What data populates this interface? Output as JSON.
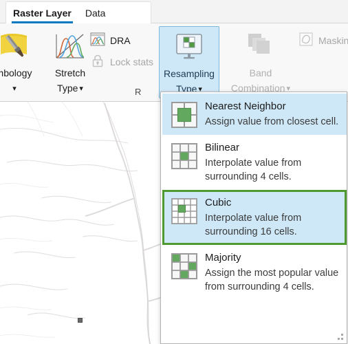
{
  "window": {
    "tabs": [
      {
        "label": "Raster Layer",
        "active": true
      },
      {
        "label": "Data",
        "active": false
      }
    ]
  },
  "ribbon": {
    "group_label_rendering": "R",
    "buttons": [
      {
        "id": "symbology",
        "label_line1": "mbology",
        "label_line2": "",
        "icon": "symbology-icon",
        "state": "enabled",
        "has_chevron": true
      },
      {
        "id": "stretch-type",
        "label_line1": "Stretch",
        "label_line2": "Type",
        "icon": "stretch-type-icon",
        "state": "enabled",
        "has_chevron": true
      },
      {
        "id": "resampling-type",
        "label_line1": "Resampling",
        "label_line2": "Type",
        "icon": "resampling-type-icon",
        "state": "active",
        "has_chevron": true
      },
      {
        "id": "band-combination",
        "label_line1": "Band",
        "label_line2": "Combination",
        "icon": "band-combination-icon",
        "state": "disabled",
        "has_chevron": true
      }
    ],
    "small_buttons": [
      {
        "id": "dra",
        "label": "DRA",
        "icon": "dra-histogram-icon",
        "state": "enabled"
      },
      {
        "id": "lock-stats",
        "label": "Lock stats",
        "icon": "lock-icon",
        "state": "disabled"
      },
      {
        "id": "masking",
        "label": "Masking",
        "icon": "masking-icon",
        "state": "disabled"
      }
    ]
  },
  "dropdown": {
    "name": "resampling-type-gallery",
    "items": [
      {
        "id": "nearest-neighbor",
        "title": "Nearest Neighbor",
        "description": "Assign value from closest cell.",
        "icon": "grid-2x2-center-cell-icon",
        "state": "hover"
      },
      {
        "id": "bilinear",
        "title": "Bilinear",
        "description": "Interpolate value from surrounding 4 cells.",
        "icon": "grid-3x3-center-cell-icon",
        "state": "normal"
      },
      {
        "id": "cubic",
        "title": "Cubic",
        "description": "Interpolate value from surrounding 16 cells.",
        "icon": "grid-4x4-center-cell-icon",
        "state": "selected"
      },
      {
        "id": "majority",
        "title": "Majority",
        "description": "Assign the most popular value from surrounding 4 cells.",
        "icon": "grid-3x3-scattered-cells-icon",
        "state": "normal"
      }
    ],
    "resize_grip": "resize-grip"
  },
  "map": {
    "marker": "map-point-marker"
  },
  "colors": {
    "accent_blue": "#0079c1",
    "highlight_blue": "#cfe8f8",
    "selection_green": "#4e9a2f",
    "cell_green": "#62a85e",
    "disabled_gray": "#b0b0b0"
  }
}
